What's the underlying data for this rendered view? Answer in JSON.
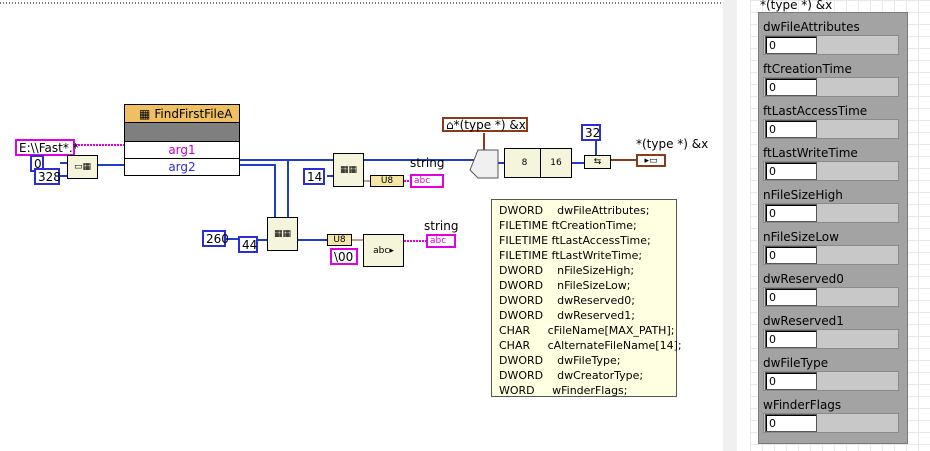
{
  "diagram": {
    "path_const": "E:\\\\Fast*.*",
    "zero_const": "0",
    "size_328": "328",
    "cfn_name": "FindFirstFileA",
    "arg1": "arg1",
    "arg2": "arg2",
    "typecast_label": "*(type *) &x",
    "typecast_label2": "*(type *) &x",
    "const_32": "32",
    "const_14": "14",
    "const_260": "260",
    "const_44": "44",
    "null_const": "\\00",
    "string_label_1": "string",
    "string_label_2": "string",
    "abc": "abc",
    "u8": "U8",
    "byte_8": "8",
    "byte_16": "16"
  },
  "tooltip": {
    "lines": [
      "DWORD    dwFileAttributes;",
      "FILETIME ftCreationTime;",
      "FILETIME ftLastAccessTime;",
      "FILETIME ftLastWriteTime;",
      "DWORD    nFileSizeHigh;",
      "DWORD    nFileSizeLow;",
      "DWORD    dwReserved0;",
      "DWORD    dwReserved1;",
      "CHAR     cFileName[MAX_PATH];",
      "CHAR     cAlternateFileName[14];",
      "DWORD    dwFileType;",
      "DWORD    dwCreatorType;",
      "WORD     wFinderFlags;"
    ]
  },
  "front_panel": {
    "cluster_title": "*(type *) &x",
    "fields": [
      {
        "label": "dwFileAttributes",
        "value": "0"
      },
      {
        "label": "ftCreationTime",
        "value": "0"
      },
      {
        "label": "ftLastAccessTime",
        "value": "0"
      },
      {
        "label": "ftLastWriteTime",
        "value": "0"
      },
      {
        "label": "nFileSizeHigh",
        "value": "0"
      },
      {
        "label": "nFileSizeLow",
        "value": "0"
      },
      {
        "label": "dwReserved0",
        "value": "0"
      },
      {
        "label": "dwReserved1",
        "value": "0"
      },
      {
        "label": "dwFileType",
        "value": "0"
      },
      {
        "label": "wFinderFlags",
        "value": "0"
      }
    ]
  },
  "colors": {
    "wire_blue": "#1f3fc8",
    "wire_pink": "#e000e0",
    "wire_brown": "#8b3a1a",
    "cfn_header": "#f0c060",
    "tooltip_bg": "#ffffe1",
    "cluster_bg": "#a3a3a3"
  }
}
